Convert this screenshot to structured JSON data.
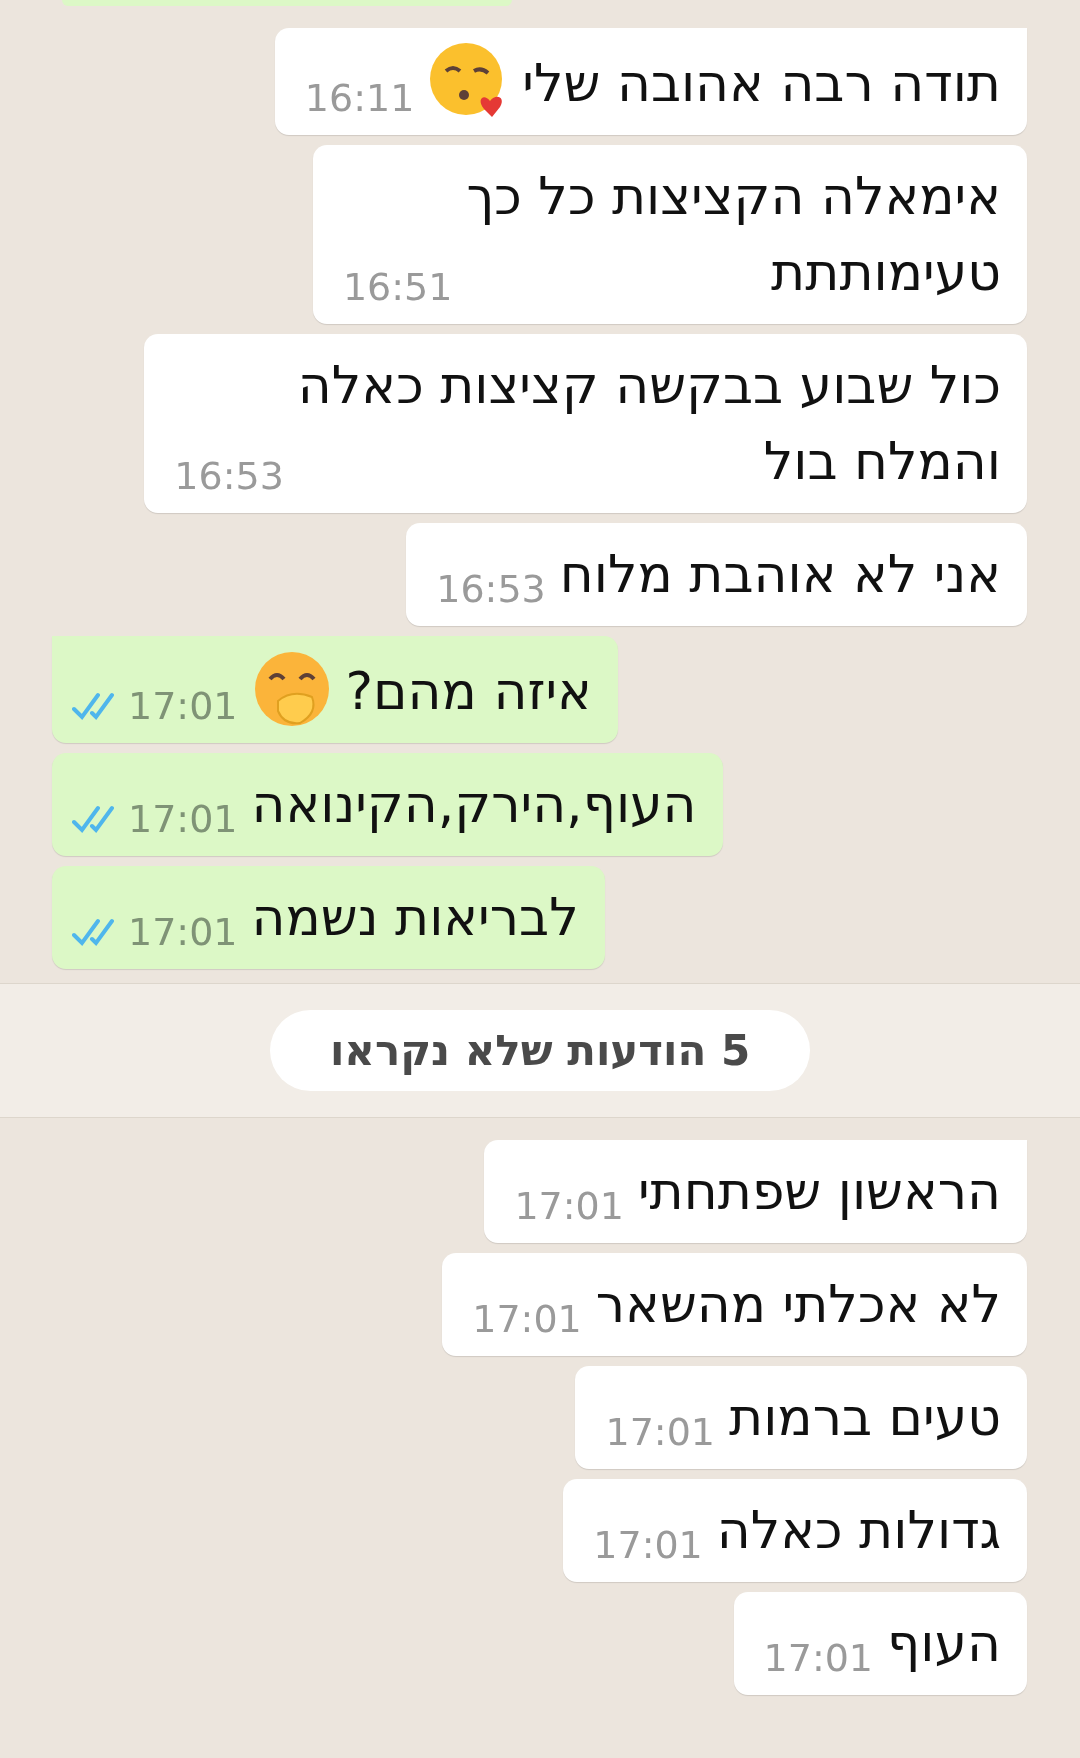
{
  "cut_bubble": {
    "kind": "out"
  },
  "messages": [
    {
      "kind": "in",
      "tail": true,
      "lines": [
        "תודה רבה אהובה שלי"
      ],
      "emoji": {
        "kind": "kiss"
      },
      "time": "16:11"
    },
    {
      "kind": "in",
      "tail": false,
      "lines": [
        "אימאלה הקציצות כל כך",
        "טעימותתת"
      ],
      "time": "16:51"
    },
    {
      "kind": "in",
      "tail": false,
      "lines": [
        "כול שבוע בבקשה קציצות כאלה",
        "והמלח בול"
      ],
      "time": "16:53"
    },
    {
      "kind": "in",
      "tail": false,
      "lines": [
        "אני לא אוהבת מלוח"
      ],
      "time": "16:53"
    },
    {
      "kind": "out",
      "tail": true,
      "lines": [
        "איזה מהם?"
      ],
      "emoji": {
        "kind": "hand_over_mouth"
      },
      "time": "17:01",
      "read": true
    },
    {
      "kind": "out",
      "tail": false,
      "lines": [
        "העוף,הירק,הקינואה"
      ],
      "time": "17:01",
      "read": true
    },
    {
      "kind": "out",
      "tail": false,
      "lines": [
        "לבריאות נשמה"
      ],
      "time": "17:01",
      "read": true
    }
  ],
  "unread_banner": "5 הודעות שלא נקראו",
  "messages_after": [
    {
      "kind": "in",
      "tail": true,
      "lines": [
        "הראשון שפתחתי"
      ],
      "time": "17:01"
    },
    {
      "kind": "in",
      "tail": false,
      "lines": [
        "לא אכלתי מהשאר"
      ],
      "time": "17:01"
    },
    {
      "kind": "in",
      "tail": false,
      "lines": [
        "טעים ברמות"
      ],
      "time": "17:01"
    },
    {
      "kind": "in",
      "tail": false,
      "lines": [
        "גדולות כאלה"
      ],
      "time": "17:01"
    },
    {
      "kind": "in",
      "tail": false,
      "lines": [
        "העוף"
      ],
      "time": "17:01"
    }
  ]
}
